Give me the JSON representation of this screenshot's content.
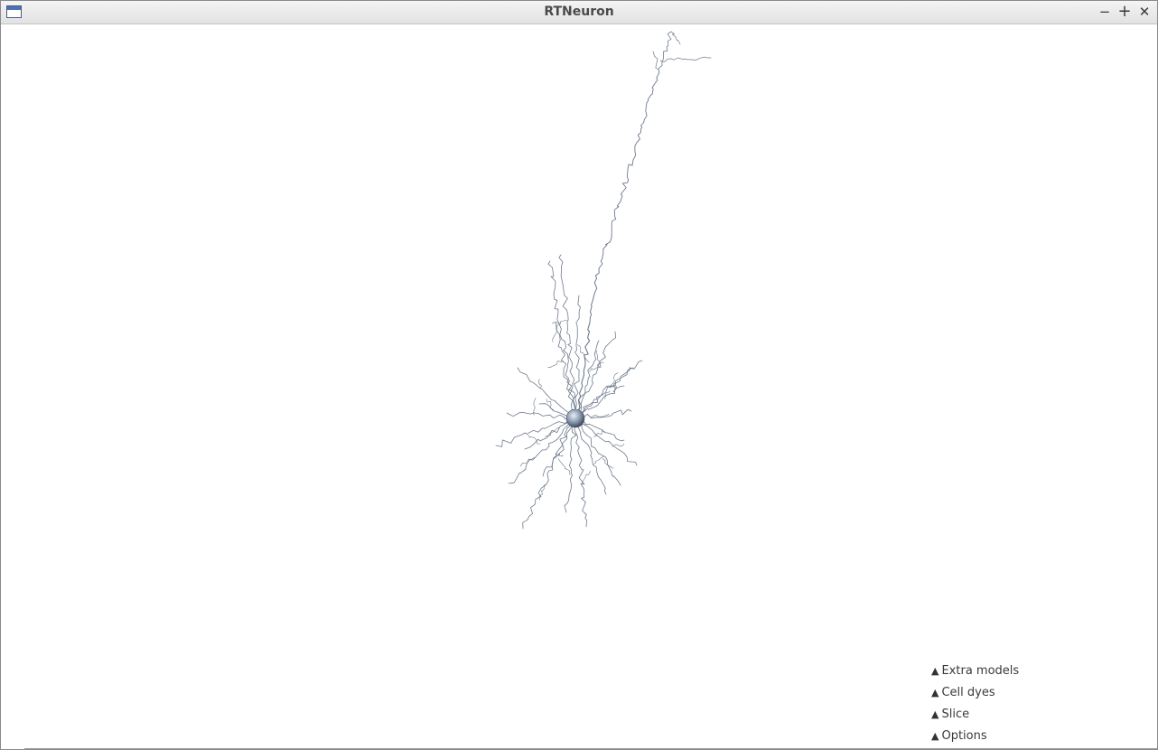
{
  "window": {
    "title": "RTNeuron",
    "icon": "app-window-icon",
    "controls": {
      "minimize": "−",
      "maximize": "+",
      "close": "✕"
    }
  },
  "panels": [
    {
      "label": "Extra models",
      "arrow": "▲"
    },
    {
      "label": "Cell dyes",
      "arrow": "▲"
    },
    {
      "label": "Slice",
      "arrow": "▲"
    },
    {
      "label": "Options",
      "arrow": "▲"
    }
  ],
  "colors": {
    "neurite": "#6f7b8c",
    "soma": "#8c9cb0",
    "background": "#ffffff"
  }
}
